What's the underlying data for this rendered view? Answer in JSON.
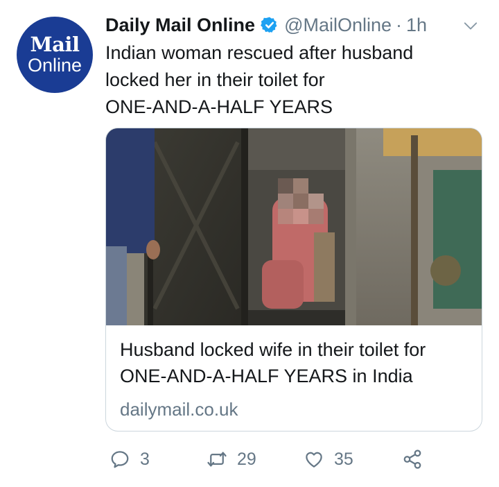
{
  "tweet": {
    "author_name": "Daily Mail Online",
    "handle": "@MailOnline",
    "separator": "·",
    "time": "1h",
    "text_lines": [
      "Indian woman rescued after husband",
      "locked her in their toilet for",
      "ONE-AND-A-HALF YEARS"
    ]
  },
  "avatar": {
    "line1": "Mail",
    "line2": "Online",
    "background": "#1a3c94"
  },
  "card": {
    "title_lines": [
      "Husband locked wife in their toilet for",
      "ONE-AND-A-HALF YEARS in India"
    ],
    "domain": "dailymail.co.uk"
  },
  "actions": {
    "replies": "3",
    "retweets": "29",
    "likes": "35"
  },
  "colors": {
    "text": "#14171a",
    "secondary": "#657786",
    "verified": "#1da1f2",
    "border": "#ccd6dd"
  },
  "icons": [
    "verified-badge-icon",
    "chevron-down-icon",
    "reply-icon",
    "retweet-icon",
    "like-icon",
    "share-icon"
  ]
}
